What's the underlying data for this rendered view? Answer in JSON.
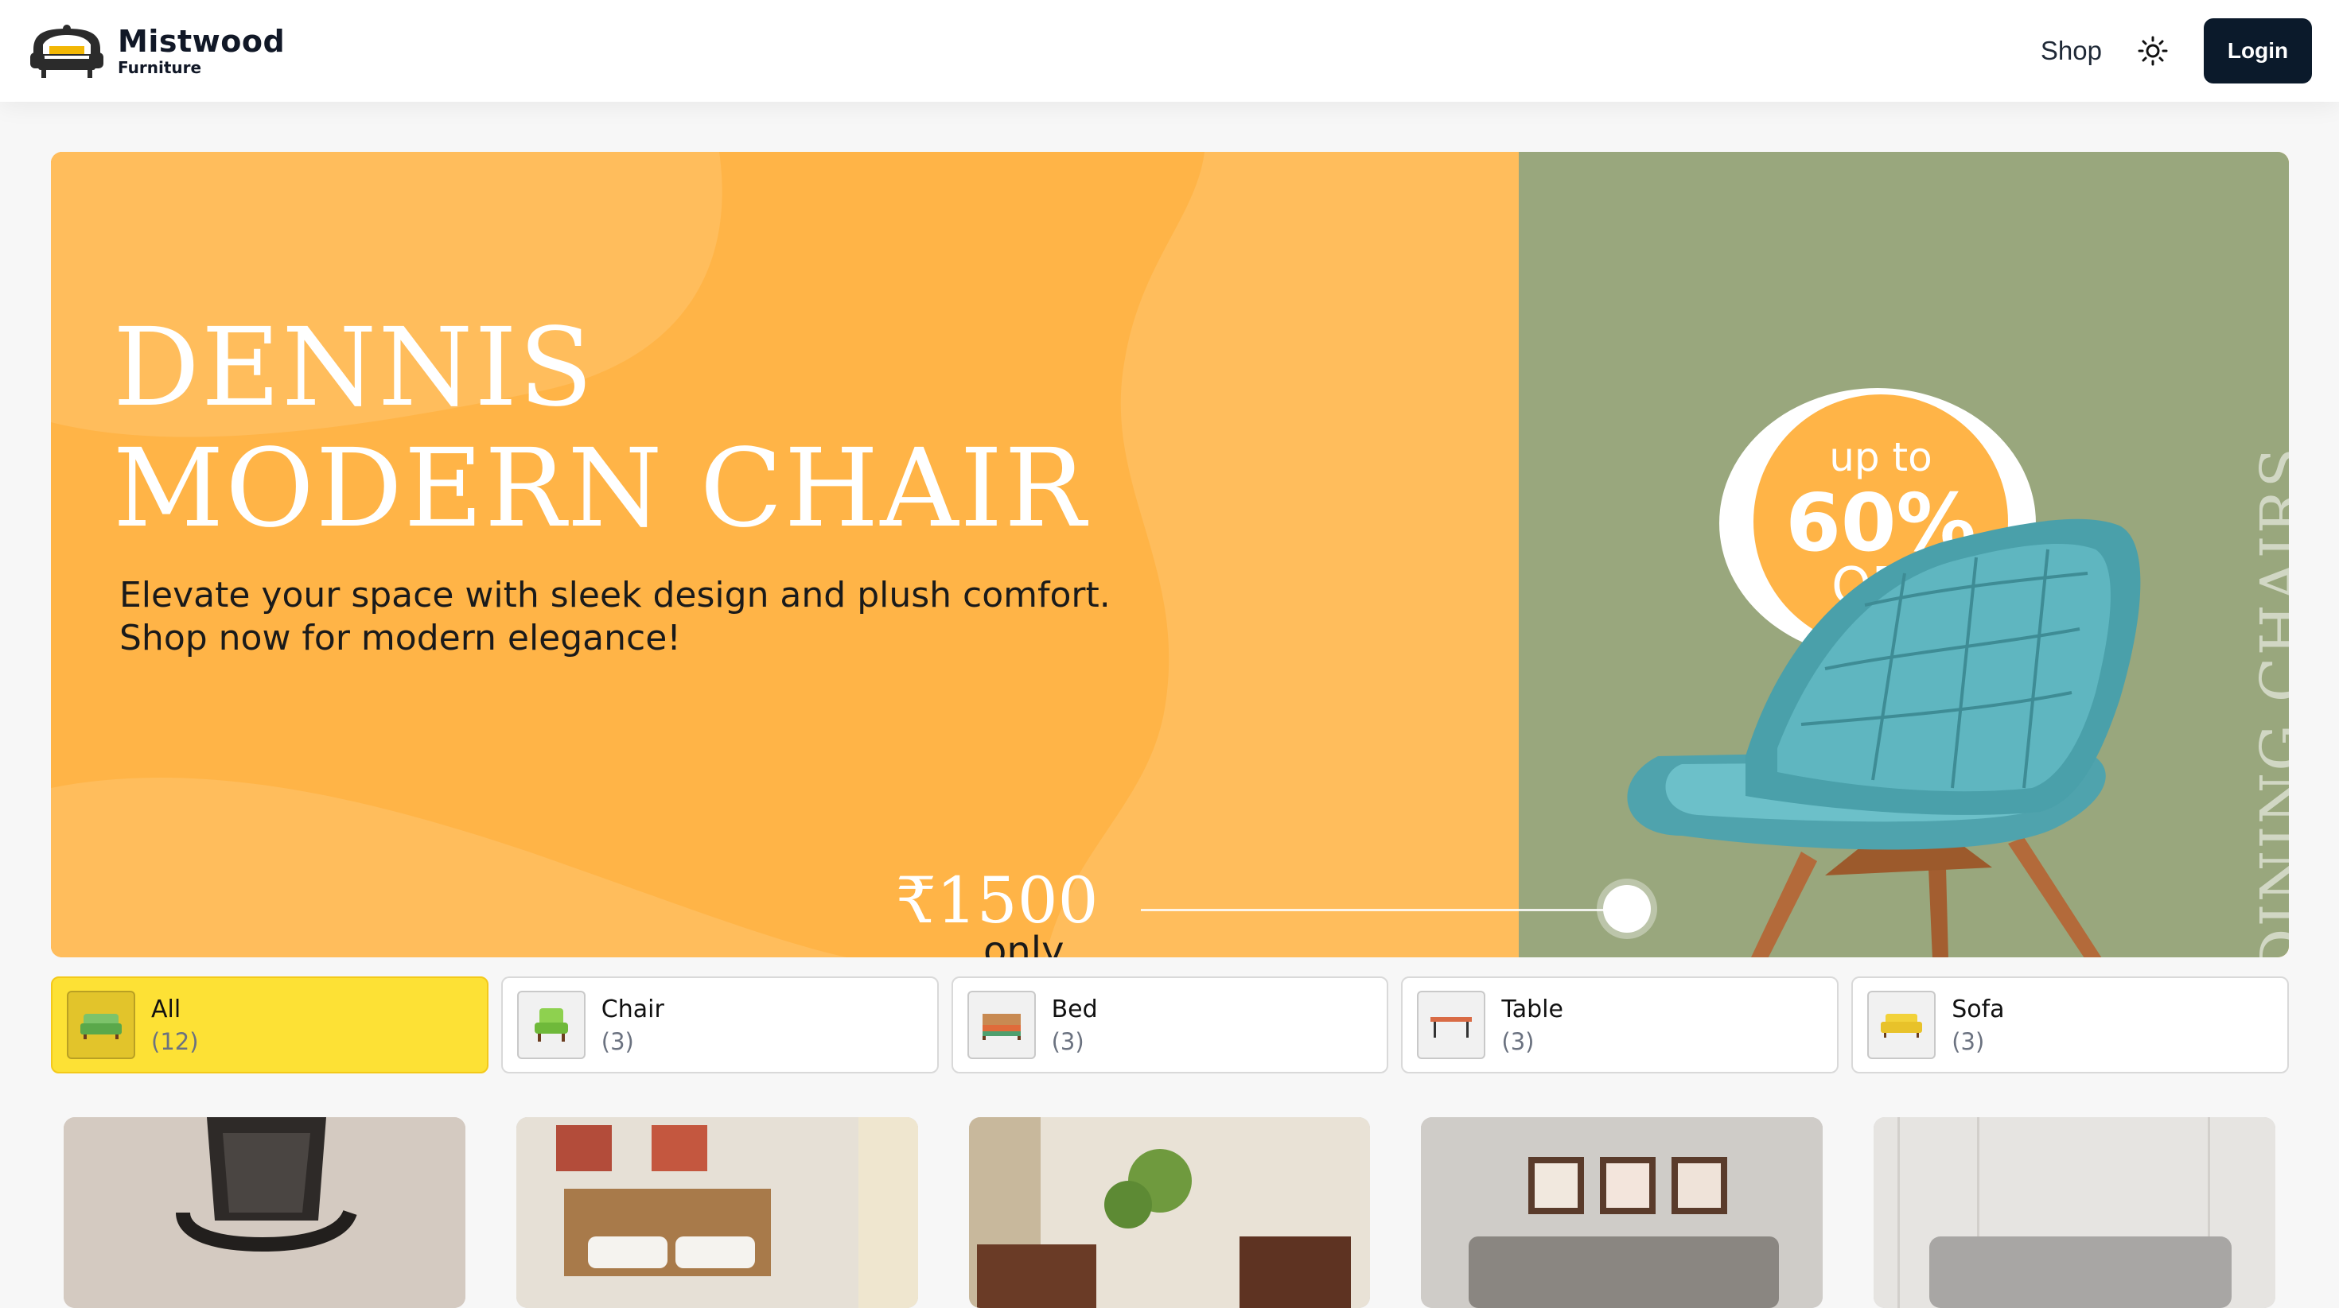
{
  "header": {
    "brand_name": "Mistwood",
    "brand_sub": "Furniture",
    "nav_shop": "Shop",
    "login_label": "Login"
  },
  "hero": {
    "title_line1": "DENNIS",
    "title_line2": "MODERN CHAIR",
    "desc_line1": "Elevate your space with sleek design and plush comfort.",
    "desc_line2": "Shop now for modern elegance!",
    "price": "₹1500",
    "price_suffix": "only",
    "badge_up": "up to",
    "badge_pct": "60%",
    "badge_off": "OFF",
    "vertical_text": "DINING CHAIRS"
  },
  "categories": [
    {
      "name": "All",
      "count": "(12)",
      "active": true
    },
    {
      "name": "Chair",
      "count": "(3)",
      "active": false
    },
    {
      "name": "Bed",
      "count": "(3)",
      "active": false
    },
    {
      "name": "Table",
      "count": "(3)",
      "active": false
    },
    {
      "name": "Sofa",
      "count": "(3)",
      "active": false
    }
  ],
  "colors": {
    "hero_orange": "#ffb447",
    "hero_green": "#99a77d",
    "active_tab": "#fde135",
    "login_bg": "#0b1a2b"
  },
  "icons": {
    "logo": "sofa-logo-icon",
    "theme": "sun-icon"
  }
}
